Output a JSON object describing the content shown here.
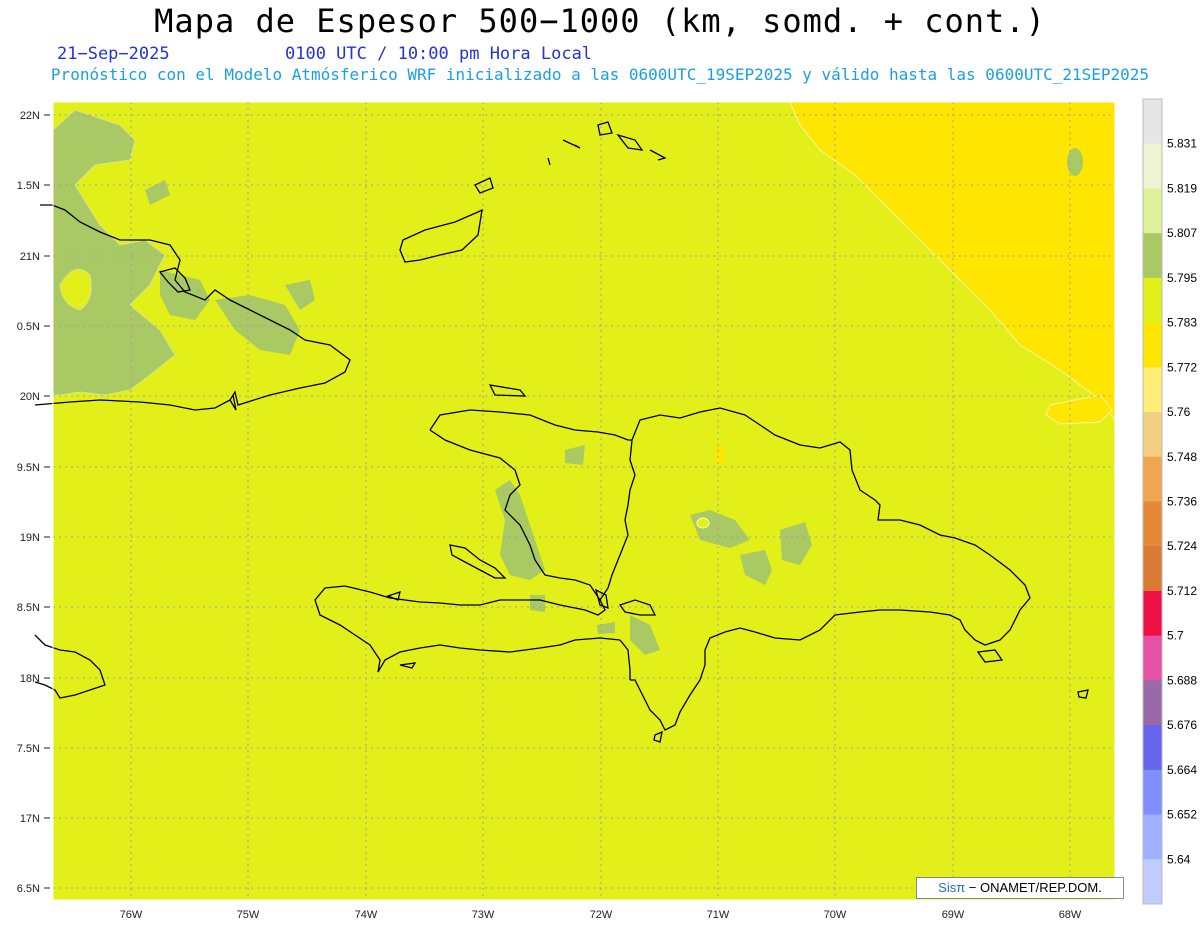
{
  "title": "Mapa de Espesor 500−1000 (km, somd. + cont.)",
  "date": "21−Sep−2025",
  "time": "0100 UTC / 10:00 pm Hora Local",
  "subtitle": "Pronóstico con el Modelo Atmósferico WRF inicializado a las 0600UTC_19SEP2025 y válido hasta las  0600UTC_21SEP2025",
  "credit": {
    "brand": "Sisπ",
    "text": " − ONAMET/REP.DOM."
  },
  "lat_labels": [
    "22N",
    "1.5N",
    "21N",
    "0.5N",
    "20N",
    "9.5N",
    "19N",
    "8.5N",
    "18N",
    "7.5N",
    "17N",
    "6.5N"
  ],
  "lon_labels": [
    "76W",
    "75W",
    "74W",
    "73W",
    "72W",
    "71W",
    "70W",
    "69W",
    "68W"
  ],
  "colorbar": {
    "labels": [
      "5.831",
      "5.819",
      "5.807",
      "5.795",
      "5.783",
      "5.772",
      "5.76",
      "5.748",
      "5.736",
      "5.724",
      "5.712",
      "5.7",
      "5.688",
      "5.676",
      "5.664",
      "5.652",
      "5.64"
    ],
    "colors": [
      "#e6e6e6",
      "#eef4d2",
      "#dff09a",
      "#a9c964",
      "#e2ef19",
      "#ffe600",
      "#ffee77",
      "#f3cf83",
      "#f0a650",
      "#e58938",
      "#db7a35",
      "#ee1045",
      "#e552a5",
      "#9a6aa8",
      "#6565ee",
      "#7f8ffe",
      "#9eb0ff",
      "#c0ccff"
    ]
  },
  "colors": {
    "field": "#e2ef19",
    "high": "#ffe600",
    "low": "#a9c964"
  }
}
